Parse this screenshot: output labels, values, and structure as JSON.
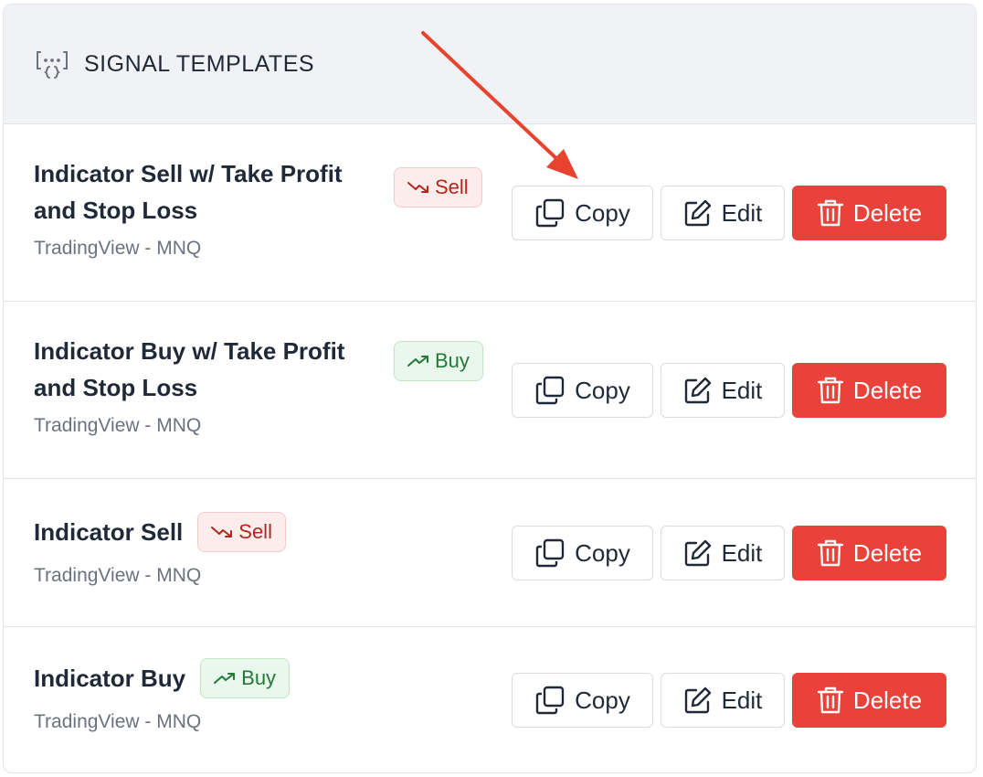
{
  "header": {
    "title": "SIGNAL TEMPLATES",
    "icon": "variable-braces-icon"
  },
  "templates": [
    {
      "name": "Indicator Sell w/ Take Profit and Stop Loss",
      "source": "TradingView - MNQ",
      "badge": "Sell",
      "badge_type": "sell"
    },
    {
      "name": "Indicator Buy w/ Take Profit and Stop Loss",
      "source": "TradingView - MNQ",
      "badge": "Buy",
      "badge_type": "buy"
    },
    {
      "name": "Indicator Sell",
      "source": "TradingView - MNQ",
      "badge": "Sell",
      "badge_type": "sell"
    },
    {
      "name": "Indicator Buy",
      "source": "TradingView - MNQ",
      "badge": "Buy",
      "badge_type": "buy"
    }
  ],
  "actions": {
    "copy_label": "Copy",
    "edit_label": "Edit",
    "delete_label": "Delete"
  },
  "colors": {
    "delete": "#e8423a",
    "sell_text": "#b4261c",
    "buy_text": "#237a37",
    "annotation_arrow": "#e8432e"
  }
}
